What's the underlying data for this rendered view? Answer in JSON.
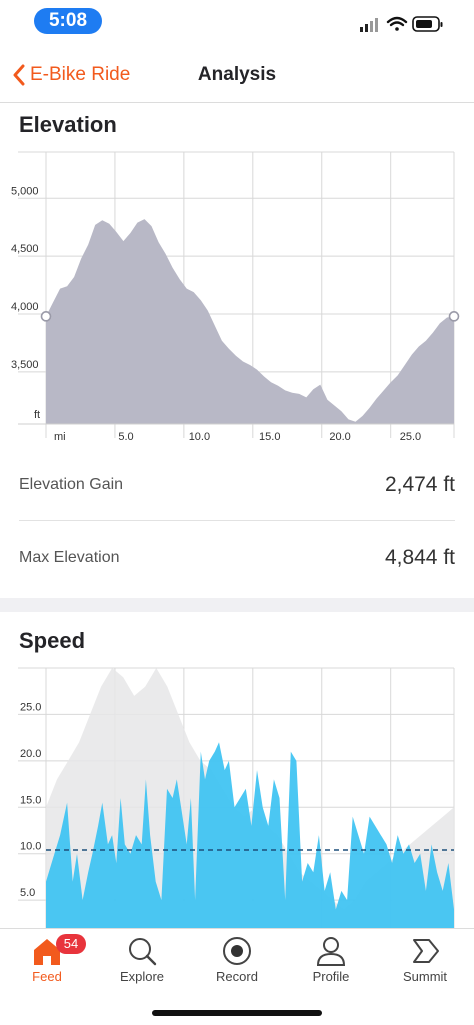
{
  "status": {
    "time": "5:08"
  },
  "nav": {
    "back_label": "E-Bike Ride",
    "title": "Analysis"
  },
  "elevation": {
    "title": "Elevation",
    "gain_label": "Elevation Gain",
    "gain_value": "2,474 ft",
    "max_label": "Max Elevation",
    "max_value": "4,844 ft"
  },
  "speed": {
    "title": "Speed"
  },
  "colors": {
    "accent": "#f25a1d",
    "elevation_fill": "#b8b8c6",
    "speed_fill": "#3cc2f2",
    "badge": "#e8343c"
  },
  "chart_data": [
    {
      "type": "area",
      "title": "Elevation",
      "xlabel": "mi",
      "ylabel": "ft",
      "xlim": [
        0,
        29
      ],
      "ylim": [
        3050,
        5400
      ],
      "x_ticks": [
        "5.0",
        "10.0",
        "15.0",
        "20.0",
        "25.0"
      ],
      "y_ticks": [
        "3,500",
        "4,000",
        "4,500",
        "5,000"
      ],
      "x": [
        0,
        0.5,
        1,
        1.5,
        2,
        2.5,
        3,
        3.5,
        4,
        4.5,
        5,
        5.5,
        6,
        6.5,
        7,
        7.5,
        8,
        8.5,
        9,
        9.5,
        10,
        10.5,
        11,
        11.5,
        12,
        12.5,
        13,
        13.5,
        14,
        14.5,
        15,
        15.5,
        16,
        16.5,
        17,
        17.5,
        18,
        18.5,
        19,
        19.5,
        20,
        20.5,
        21,
        21.5,
        22,
        22.5,
        23,
        23.5,
        24,
        24.5,
        25,
        25.5,
        26,
        26.5,
        27,
        27.5,
        28,
        28.5,
        29
      ],
      "values": [
        3980,
        4100,
        4220,
        4240,
        4320,
        4480,
        4600,
        4770,
        4810,
        4780,
        4710,
        4630,
        4700,
        4790,
        4820,
        4760,
        4620,
        4520,
        4400,
        4300,
        4220,
        4190,
        4120,
        4030,
        3900,
        3770,
        3700,
        3640,
        3590,
        3560,
        3520,
        3460,
        3410,
        3380,
        3340,
        3320,
        3310,
        3280,
        3350,
        3390,
        3260,
        3210,
        3160,
        3090,
        3070,
        3120,
        3190,
        3270,
        3340,
        3410,
        3470,
        3560,
        3650,
        3720,
        3770,
        3840,
        3920,
        3970,
        3980
      ]
    },
    {
      "type": "area",
      "title": "Speed",
      "xlim": [
        0,
        29
      ],
      "ylim": [
        2,
        30
      ],
      "y_ticks": [
        "5.0",
        "10.0",
        "15.0",
        "20.0",
        "25.0"
      ],
      "average": 10.4,
      "x": [
        0,
        0.5,
        1,
        1.5,
        1.9,
        2.2,
        2.6,
        3,
        3.3,
        3.7,
        4,
        4.4,
        4.7,
        5,
        5.3,
        5.6,
        6,
        6.4,
        6.8,
        7.1,
        7.4,
        7.8,
        8.2,
        8.6,
        9,
        9.3,
        9.6,
        10,
        10.3,
        10.6,
        11,
        11.3,
        11.6,
        12,
        12.3,
        12.7,
        13,
        13.4,
        13.8,
        14.2,
        14.6,
        15,
        15.4,
        15.8,
        16.2,
        16.6,
        17,
        17.4,
        17.8,
        18.2,
        18.6,
        19,
        19.4,
        19.8,
        20.2,
        20.6,
        21,
        21.4,
        21.8,
        22.2,
        22.6,
        23,
        23.4,
        23.8,
        24.2,
        24.6,
        25,
        25.4,
        25.8,
        26.2,
        26.6,
        27,
        27.4,
        27.8,
        28.2,
        28.6,
        29
      ],
      "values": [
        7,
        9.5,
        12,
        15.5,
        7,
        10,
        5,
        8,
        10,
        13,
        15.5,
        11,
        12,
        9,
        16,
        11,
        10,
        12,
        11,
        18,
        12,
        7,
        5,
        17,
        16,
        18,
        15,
        11,
        16,
        5,
        21,
        18,
        20,
        21,
        22,
        19,
        20,
        15,
        16,
        17,
        13,
        19,
        15,
        13,
        18,
        16,
        5,
        21,
        20,
        7,
        9,
        8,
        12,
        6,
        8,
        4,
        6,
        5,
        14,
        12,
        10,
        14,
        13,
        12,
        11,
        9,
        12,
        10,
        11,
        9,
        10,
        6,
        11,
        8,
        6,
        9,
        4
      ],
      "background_values": [
        15,
        18,
        20,
        22,
        25,
        28,
        30,
        29,
        27,
        28,
        30,
        28,
        25,
        22,
        20,
        19,
        17,
        15,
        14,
        15,
        13,
        12,
        10,
        8,
        7,
        6,
        5,
        4,
        5,
        7,
        8,
        9,
        10,
        11,
        12,
        13,
        14,
        15
      ]
    }
  ]
}
